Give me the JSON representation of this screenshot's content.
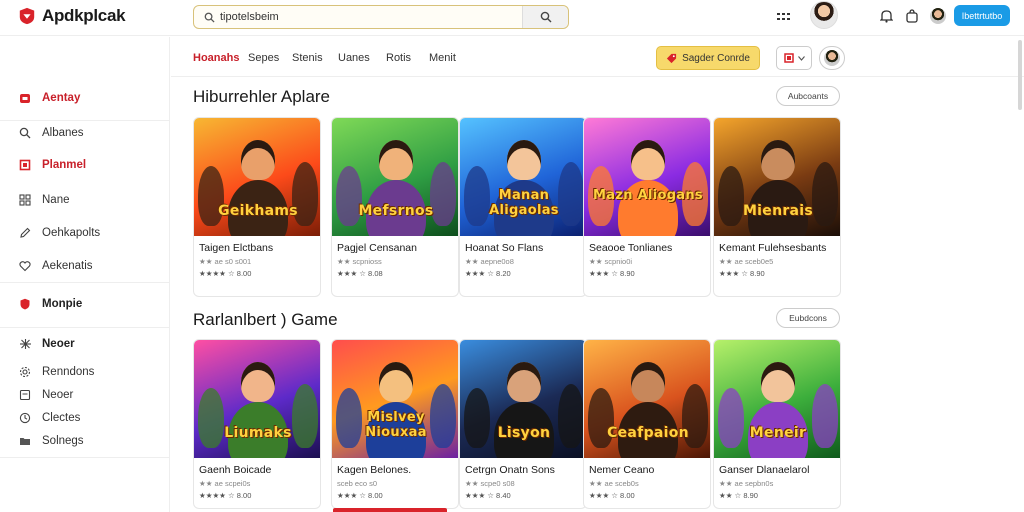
{
  "app": {
    "name": "Apdkplcak",
    "brand_color": "#d9232a",
    "accent_color": "#1a9be6"
  },
  "search": {
    "value": "tipotelsbeim",
    "placeholder": ""
  },
  "header": {
    "signin_label": "Ibettrtutbo"
  },
  "sidebar": {
    "items": [
      {
        "label": "Aentay",
        "icon": "home-icon",
        "style": "red"
      },
      {
        "label": "Albanes",
        "icon": "search-icon",
        "style": "normal"
      },
      {
        "label": "Planmel",
        "icon": "bookmark-icon",
        "style": "red"
      },
      {
        "label": "Nane",
        "icon": "grid-icon",
        "style": "normal"
      },
      {
        "label": "Oehkapolts",
        "icon": "pencil-icon",
        "style": "normal"
      },
      {
        "label": "Aekenatis",
        "icon": "heart-icon",
        "style": "normal"
      },
      {
        "label": "Monpie",
        "icon": "shield-icon",
        "style": "bold-red"
      },
      {
        "label": "Neoer",
        "icon": "gamepad-icon",
        "style": "bold"
      },
      {
        "label": "Renndons",
        "icon": "settings-icon",
        "style": "normal"
      },
      {
        "label": "Neoer",
        "icon": "list-icon",
        "style": "normal"
      },
      {
        "label": "Clectes",
        "icon": "clock-icon",
        "style": "normal"
      },
      {
        "label": "Solnegs",
        "icon": "folder-icon",
        "style": "normal"
      }
    ]
  },
  "subnav": {
    "tabs": [
      "Hoanahs",
      "Sepes",
      "Stenis",
      "Uanes",
      "Rotis",
      "Menit"
    ],
    "special_label": "Sagder Conrde"
  },
  "sections": [
    {
      "title": "Hiburrehler Aplare",
      "see_all": "Aubcoants",
      "cards": [
        {
          "title": "Taigen Elctbans",
          "sub": "★★ ae s0 s001",
          "rating": "★★★★ ☆ 8.00",
          "art": "Geikhams"
        },
        {
          "title": "Pagjel Censanan",
          "sub": "★★ scpnioss",
          "rating": "★★★ ☆ 8.08",
          "art": "Mefsrnos"
        },
        {
          "title": "Hoanat So Flans",
          "sub": "★★ aepne0o8",
          "rating": "★★★ ☆ 8.20",
          "art": "Manan Aligaolas"
        },
        {
          "title": "Seaooe Tonlianes",
          "sub": "★★ scpnio0i",
          "rating": "★★★ ☆ 8.90",
          "art": "Mazn Aliogans"
        },
        {
          "title": "Kemant Fulehsesbants",
          "sub": "★★ ae sceb0e5",
          "rating": "★★★ ☆ 8.90",
          "art": "Mienrais"
        }
      ]
    },
    {
      "title": "Rarlanlbert ) Game",
      "see_all": "Eubdcons",
      "cards": [
        {
          "title": "Gaenh Boicade",
          "sub": "★★ ae scpei0s",
          "rating": "★★★★ ☆ 8.00",
          "art": "Liumaks"
        },
        {
          "title": "Kagen Belones.",
          "sub": "sceb eco s0",
          "rating": "★★★ ☆ 8.00",
          "art": "Mislvey Niouxaa"
        },
        {
          "title": "Cetrgn Onatn Sons",
          "sub": "★★ scpe0 s08",
          "rating": "★★★ ☆ 8.40",
          "art": "Lisyon"
        },
        {
          "title": "Nemer Ceano",
          "sub": "★★ ae sceb0s",
          "rating": "★★★ ☆ 8.00",
          "art": "Ceafpaion"
        },
        {
          "title": "Ganser Dlanaelarol",
          "sub": "★★ ae sepbn0s",
          "rating": "★★ ☆ 8.90",
          "art": "Meneir"
        }
      ]
    }
  ]
}
